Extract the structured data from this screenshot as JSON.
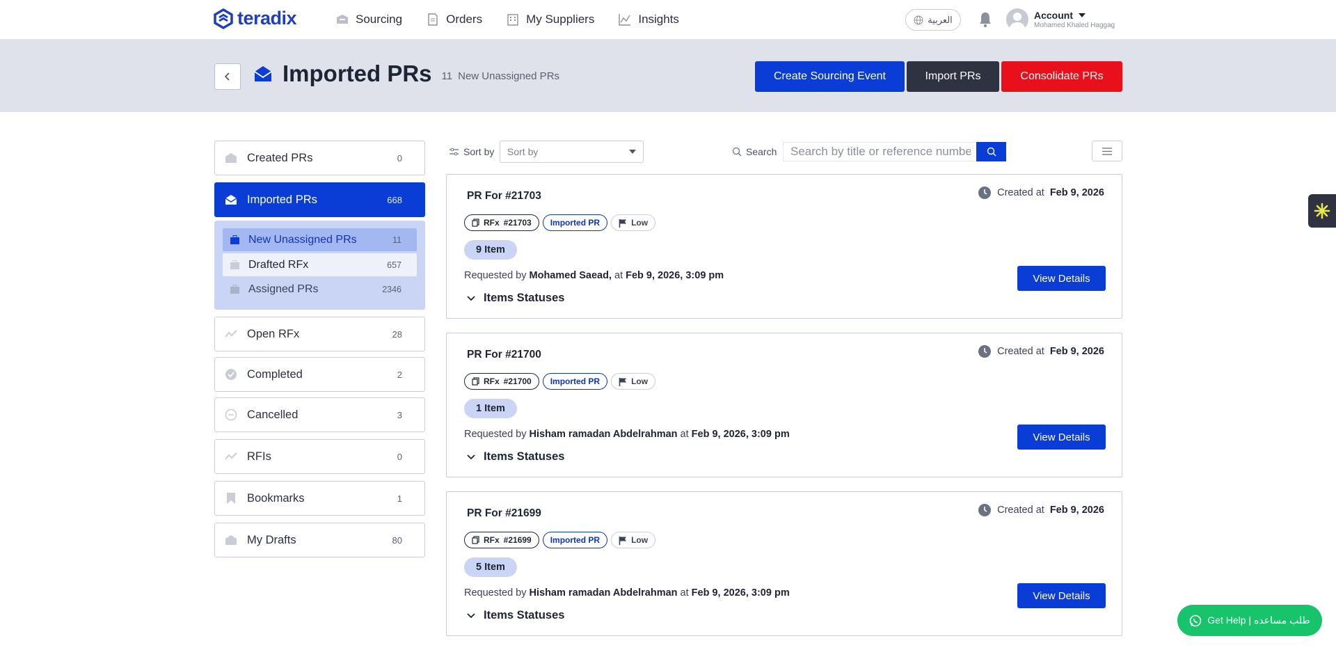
{
  "header": {
    "logo_text": "teradix",
    "nav": [
      {
        "label": "Sourcing",
        "icon": "box-icon"
      },
      {
        "label": "Orders",
        "icon": "document-icon"
      },
      {
        "label": "My Suppliers",
        "icon": "building-icon"
      },
      {
        "label": "Insights",
        "icon": "chart-icon"
      }
    ],
    "language": "العربية",
    "account_title": "Account",
    "account_name": "Mohamed Khaled Haggag"
  },
  "banner": {
    "title": "Imported PRs",
    "sub_count": "11",
    "sub_label": "New Unassigned PRs",
    "buttons": {
      "create": "Create Sourcing Event",
      "import": "Import PRs",
      "consolidate": "Consolidate PRs"
    },
    "colors": {
      "primary": "#0a3cd6",
      "dark": "#2f3240",
      "danger": "#e8101b"
    }
  },
  "sidebar": {
    "items": [
      {
        "label": "Created PRs",
        "count": "0"
      },
      {
        "label": "Imported PRs",
        "count": "668"
      },
      {
        "label": "Open RFx",
        "count": "28"
      },
      {
        "label": "Completed",
        "count": "2"
      },
      {
        "label": "Cancelled",
        "count": "3"
      },
      {
        "label": "RFIs",
        "count": "0"
      },
      {
        "label": "Bookmarks",
        "count": "1"
      },
      {
        "label": "My Drafts",
        "count": "80"
      }
    ],
    "sub_items": [
      {
        "label": "New Unassigned PRs",
        "count": "11"
      },
      {
        "label": "Drafted RFx",
        "count": "657"
      },
      {
        "label": "Assigned PRs",
        "count": "2346"
      }
    ]
  },
  "toolbar": {
    "sort_label": "Sort by",
    "sort_value": "Sort by",
    "search_label": "Search",
    "search_placeholder": "Search by title or reference number"
  },
  "cards": [
    {
      "title": "PR For #21703",
      "created_label": "Created at",
      "created_date": "Feb 9, 2026",
      "rfx_label": "RFx",
      "rfx_ref": "#21703",
      "type_tag": "Imported PR",
      "priority": "Low",
      "items": "9 Item",
      "requested_by_label": "Requested by",
      "requester": "Mohamed Saead,",
      "at_label": "at",
      "requested_at": "Feb 9, 2026, 3:09 pm",
      "statuses_label": "Items Statuses",
      "view_label": "View Details"
    },
    {
      "title": "PR For #21700",
      "created_label": "Created at",
      "created_date": "Feb 9, 2026",
      "rfx_label": "RFx",
      "rfx_ref": "#21700",
      "type_tag": "Imported PR",
      "priority": "Low",
      "items": "1 Item",
      "requested_by_label": "Requested by",
      "requester": "Hisham ramadan Abdelrahman",
      "at_label": "at",
      "requested_at": "Feb 9, 2026, 3:09 pm",
      "statuses_label": "Items Statuses",
      "view_label": "View Details"
    },
    {
      "title": "PR For #21699",
      "created_label": "Created at",
      "created_date": "Feb 9, 2026",
      "rfx_label": "RFx",
      "rfx_ref": "#21699",
      "type_tag": "Imported PR",
      "priority": "Low",
      "items": "5 Item",
      "requested_by_label": "Requested by",
      "requester": "Hisham ramadan Abdelrahman",
      "at_label": "at",
      "requested_at": "Feb 9, 2026, 3:09 pm",
      "statuses_label": "Items Statuses",
      "view_label": "View Details"
    }
  ],
  "help": {
    "label": "Get Help | طلب مساعده",
    "color": "#17c36b"
  }
}
